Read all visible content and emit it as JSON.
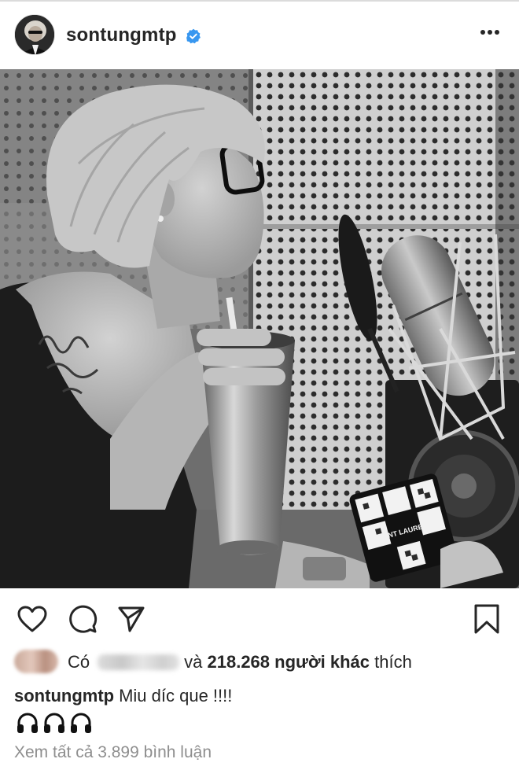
{
  "post": {
    "username": "sontungmtp",
    "verified": true,
    "caption_user": "sontungmtp",
    "caption_text": "Miu díc que !!!!",
    "caption_emojis": [
      "headphones-icon",
      "headphones-icon",
      "headphones-icon"
    ]
  },
  "likes": {
    "prefix": "Có",
    "connector": "và",
    "count": "218.268",
    "suffix_bold": "người khác",
    "suffix": "thích"
  },
  "comments": {
    "view_all": "Xem tất cả 3.899 bình luận"
  },
  "photo": {
    "stencil_text": "SAINT LAURENT",
    "tone": "black-and-white"
  },
  "icons": {
    "verified_color": "#3897f0",
    "icon_color": "#262626"
  }
}
